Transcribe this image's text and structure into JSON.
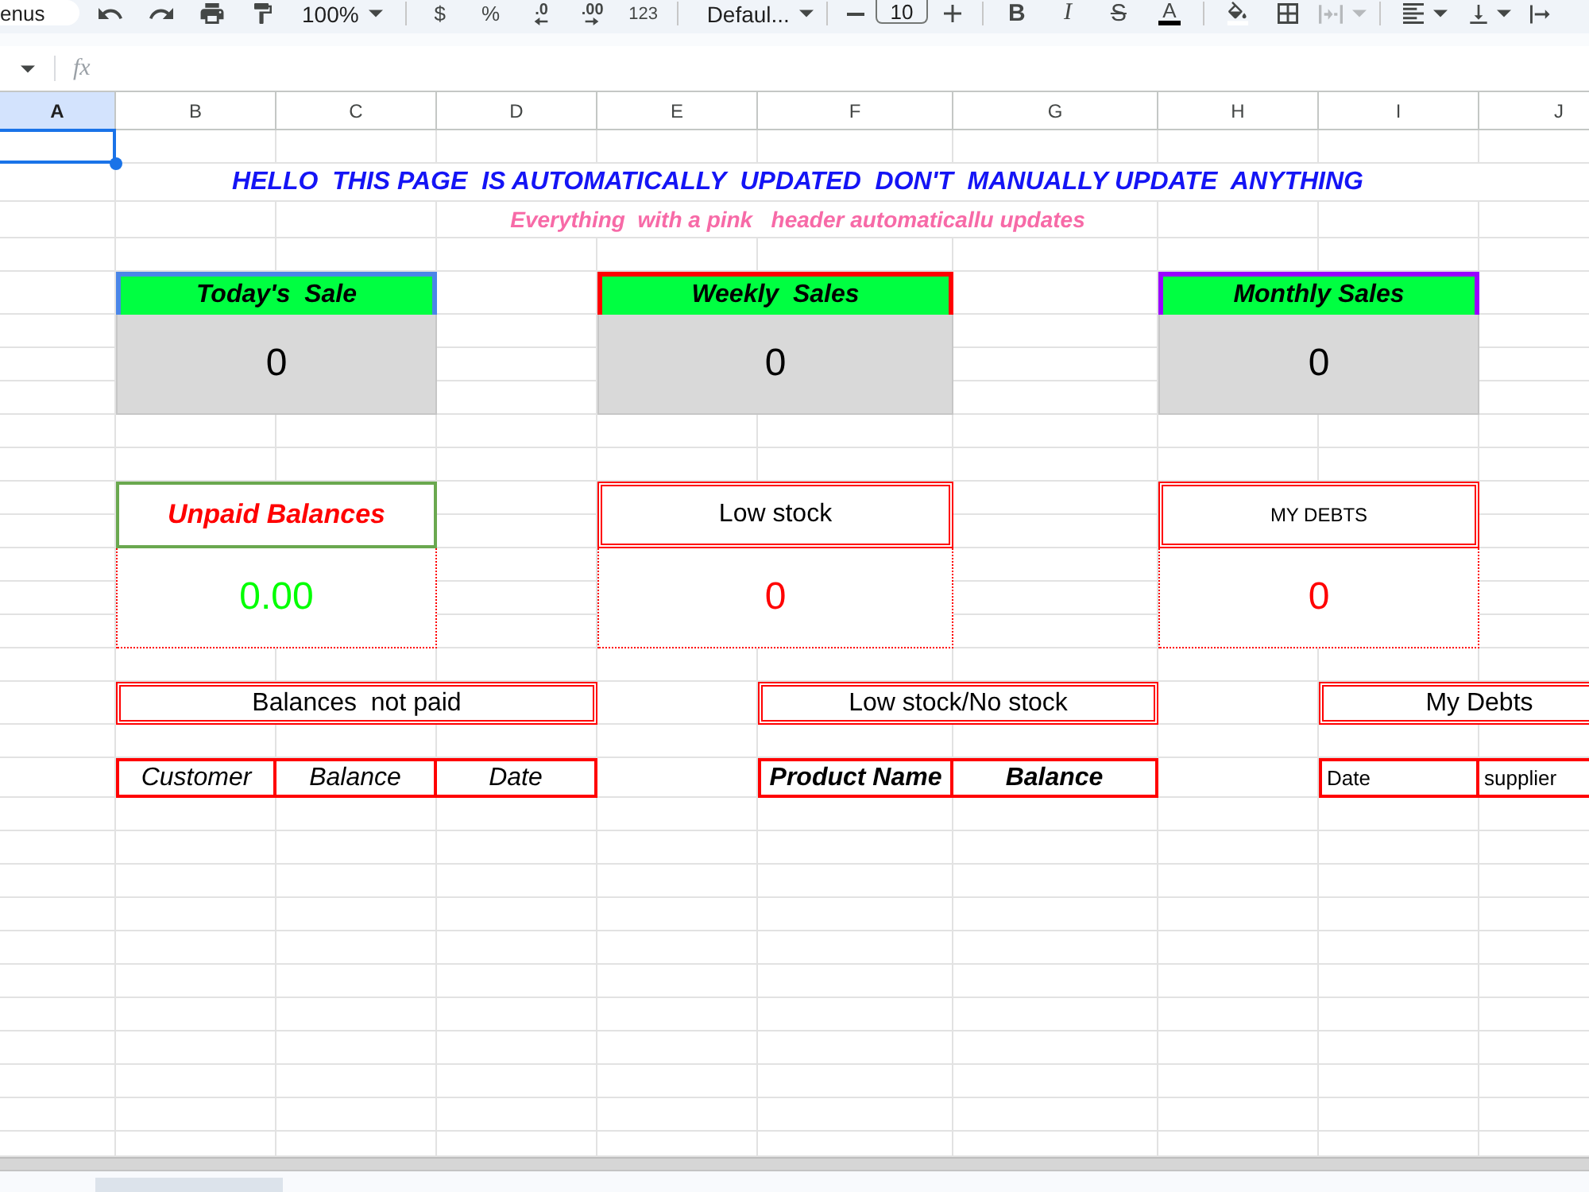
{
  "toolbar": {
    "menu_search": {
      "placeholder": "enus"
    },
    "zoom": "100%",
    "currency": "$",
    "percent": "%",
    "decrease_decimal": ".0",
    "increase_decimal": ".00",
    "number_format": "123",
    "font": "Defaul...",
    "font_size": "10",
    "bold": "B",
    "italic": "I",
    "strikethrough": "S",
    "text_color": "A",
    "merge": {
      "disabled": true
    }
  },
  "formula_bar": {
    "label": "fx"
  },
  "grid": {
    "columns": [
      {
        "label": "A",
        "selected": true
      },
      {
        "label": "B",
        "selected": false
      },
      {
        "label": "C",
        "selected": false
      },
      {
        "label": "D",
        "selected": false
      },
      {
        "label": "E",
        "selected": false
      },
      {
        "label": "F",
        "selected": false
      },
      {
        "label": "G",
        "selected": false
      },
      {
        "label": "H",
        "selected": false
      },
      {
        "label": "I",
        "selected": false
      },
      {
        "label": "J",
        "selected": false
      }
    ]
  },
  "banner": {
    "title": "HELLO  THIS PAGE  IS AUTOMATICALLY  UPDATED  DON'T  MANUALLY UPDATE  ANYTHING",
    "subtitle": "Everything  with a pink   header automaticallu updates"
  },
  "summary_cards": [
    {
      "title": "Today's  Sale",
      "value": "0",
      "color": "#4a86e8"
    },
    {
      "title": "Weekly  Sales",
      "value": "0",
      "color": "#ff0000"
    },
    {
      "title": "Monthly Sales",
      "value": "0",
      "color": "#9900ff"
    }
  ],
  "status_cards": [
    {
      "kind": "alert",
      "title": "Unpaid Balances",
      "value": "0.00"
    },
    {
      "kind": "plain",
      "title": "Low stock",
      "value": "0"
    },
    {
      "kind": "compact",
      "title": "MY DEBTS",
      "value": "0"
    }
  ],
  "tables": [
    {
      "kind": "italic",
      "title": "Balances  not paid",
      "columns": [
        "Customer",
        "Balance",
        "Date"
      ]
    },
    {
      "kind": "bold",
      "title": "Low stock/No stock",
      "columns": [
        "Product Name",
        "Balance"
      ]
    },
    {
      "kind": "small",
      "title": "My Debts",
      "columns": [
        "Date",
        "supplier"
      ]
    }
  ],
  "sheet_tabs": [
    {
      "selected": true
    }
  ]
}
